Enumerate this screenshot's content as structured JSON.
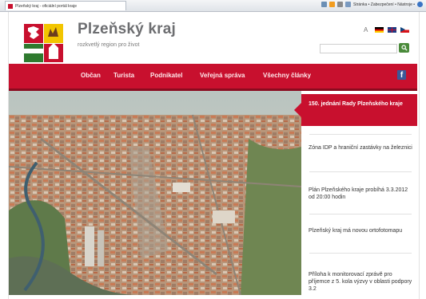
{
  "browser": {
    "tab_title": "Plzeňský kraj - oficiální portál kraje",
    "toolbar_text": "Stránka • Zabezpečení • Nástroje •"
  },
  "header": {
    "title": "Plzeňský kraj",
    "tagline": "rozkvetlý region pro život",
    "languages": [
      "de",
      "en",
      "cz"
    ],
    "search_placeholder": ""
  },
  "nav": {
    "items": [
      "Občan",
      "Turista",
      "Podnikatel",
      "Veřejná správa",
      "Všechny články"
    ],
    "facebook_label": "f"
  },
  "news": {
    "items": [
      "150. jednání Rady Plzeňského kraje",
      "Zóna IDP a hraniční zastávky na železnici",
      "Plán Plzeňského kraje probíhá 3.3.2012 od 20:00 hodin",
      "Plzeňský kraj má novou ortofotomapu",
      "Příloha k monitorovací zprávě pro příjemce z 5. kola výzvy v oblasti podpory 3.2"
    ]
  },
  "colors": {
    "brand_red": "#c8102e",
    "title_gray": "#6d6e71",
    "search_green": "#4a8a3a"
  }
}
